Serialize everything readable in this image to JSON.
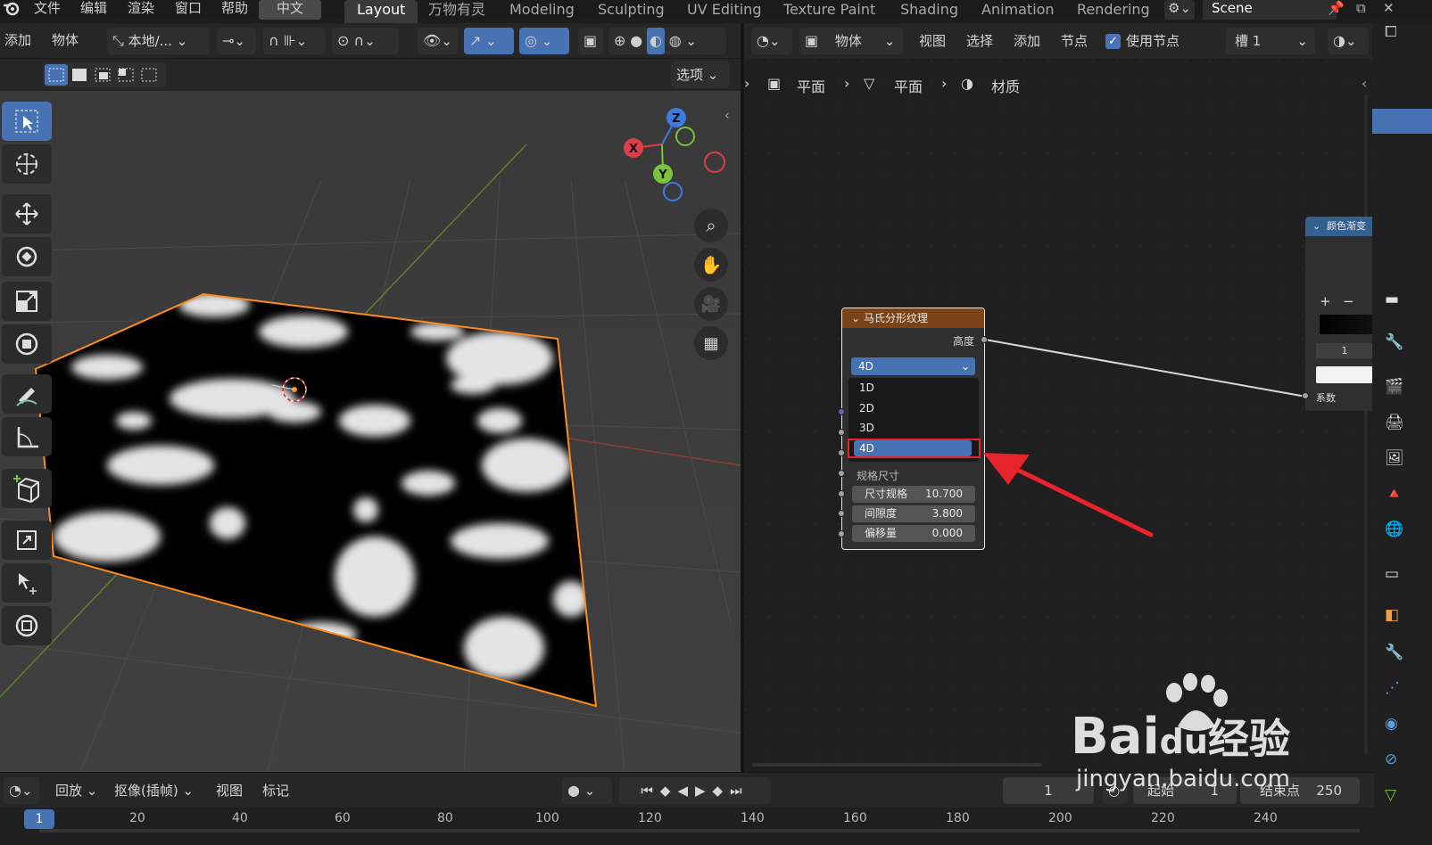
{
  "menubar": {
    "file": "文件",
    "edit": "编辑",
    "render": "渲染",
    "window": "窗口",
    "help": "帮助",
    "language": "中文"
  },
  "workspaces": [
    "Layout",
    "万物有灵",
    "Modeling",
    "Sculpting",
    "UV Editing",
    "Texture Paint",
    "Shading",
    "Animation",
    "Rendering"
  ],
  "active_workspace": "Layout",
  "scene": "Scene",
  "viewport_header": {
    "add": "添加",
    "object": "物体",
    "transform_orientation": "本地/...",
    "options": "选项"
  },
  "node_header": {
    "object_type": "物体",
    "view": "视图",
    "select": "选择",
    "add": "添加",
    "node": "节点",
    "use_nodes": "使用节点",
    "use_nodes_checked": true,
    "slot": "槽 1"
  },
  "breadcrumbs": [
    "平面",
    "平面",
    "材质"
  ],
  "musgrave_node": {
    "title": "马氏分形纹理",
    "output_label": "高度",
    "dimension": "4D",
    "options": [
      "1D",
      "2D",
      "3D",
      "4D"
    ],
    "selected_option": "4D",
    "type_label": "规格尺寸",
    "fields": [
      {
        "label": "尺寸规格",
        "value": "10.700"
      },
      {
        "label": "间隙度",
        "value": "3.800"
      },
      {
        "label": "偏移量",
        "value": "0.000"
      }
    ]
  },
  "color_ramp_node": {
    "title": "颜色渐变",
    "index": "1",
    "input_label": "系数"
  },
  "timeline": {
    "playback": "回放",
    "keying": "抠像(插帧)",
    "view": "视图",
    "marker": "标记",
    "current_frame": "1",
    "start_label": "起始",
    "start": "1",
    "end_label": "结束点",
    "end": "250"
  },
  "ruler_ticks": [
    "1",
    "20",
    "40",
    "60",
    "80",
    "100",
    "120",
    "140",
    "160",
    "180",
    "200",
    "220",
    "240"
  ],
  "gizmo": {
    "x": "X",
    "y": "Y",
    "z": "Z"
  },
  "watermark": {
    "brand": "Bai",
    "du": "du",
    "jingyan": "经验",
    "url": "jingyan.baidu.com"
  },
  "colors": {
    "accent": "#4772b3",
    "selection_outline": "#ff8c1a",
    "annotation": "#e8232a",
    "texture_node": "#7a4318",
    "converter_node": "#34608f"
  }
}
